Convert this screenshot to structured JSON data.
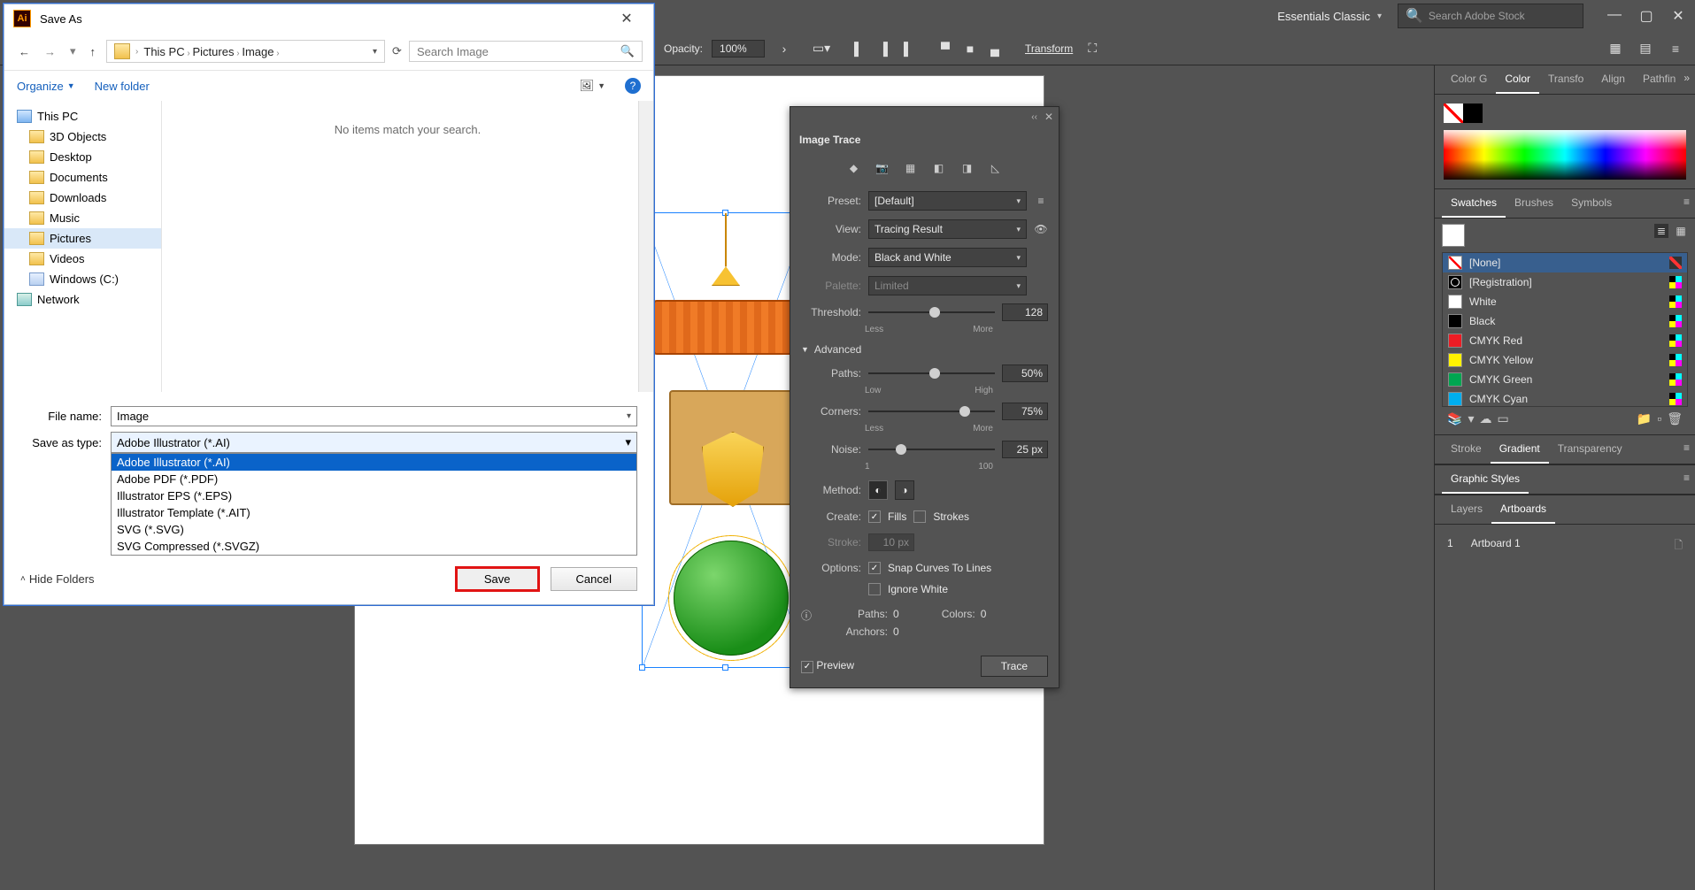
{
  "menubar": {
    "workspace": "Essentials Classic",
    "stock_placeholder": "Search Adobe Stock"
  },
  "options_bar": {
    "opacity_label": "Opacity:",
    "opacity_value": "100%",
    "transform_label": "Transform"
  },
  "image_trace": {
    "title": "Image Trace",
    "preset_label": "Preset:",
    "preset_value": "[Default]",
    "view_label": "View:",
    "view_value": "Tracing Result",
    "mode_label": "Mode:",
    "mode_value": "Black and White",
    "palette_label": "Palette:",
    "palette_value": "Limited",
    "threshold_label": "Threshold:",
    "threshold_value": "128",
    "threshold_min": "Less",
    "threshold_max": "More",
    "advanced": "Advanced",
    "paths_label": "Paths:",
    "paths_value": "50%",
    "paths_min": "Low",
    "paths_max": "High",
    "corners_label": "Corners:",
    "corners_value": "75%",
    "corners_min": "Less",
    "corners_max": "More",
    "noise_label": "Noise:",
    "noise_value": "25 px",
    "noise_min": "1",
    "noise_max": "100",
    "method_label": "Method:",
    "create_label": "Create:",
    "create_fills": "Fills",
    "create_strokes": "Strokes",
    "stroke_label": "Stroke:",
    "stroke_value": "10 px",
    "options_label": "Options:",
    "opt_snap": "Snap Curves To Lines",
    "opt_ignore": "Ignore White",
    "info_paths_k": "Paths:",
    "info_paths_v": "0",
    "info_colors_k": "Colors:",
    "info_colors_v": "0",
    "info_anchors_k": "Anchors:",
    "info_anchors_v": "0",
    "preview": "Preview",
    "trace_btn": "Trace"
  },
  "panels": {
    "color_tabs": [
      "Color G",
      "Color",
      "Transfo",
      "Align",
      "Pathfin"
    ],
    "color_active": "Color",
    "swatches_tabs": [
      "Swatches",
      "Brushes",
      "Symbols"
    ],
    "swatches_active": "Swatches",
    "swatches": [
      {
        "name": "[None]",
        "chip": "none",
        "icon": "noprint",
        "selected": true
      },
      {
        "name": "[Registration]",
        "chip": "reg",
        "icon": "cmyk"
      },
      {
        "name": "White",
        "chip": "#ffffff",
        "icon": "cmyk"
      },
      {
        "name": "Black",
        "chip": "#000000",
        "icon": "cmyk"
      },
      {
        "name": "CMYK Red",
        "chip": "#ed1c24",
        "icon": "cmyk"
      },
      {
        "name": "CMYK Yellow",
        "chip": "#fff200",
        "icon": "cmyk"
      },
      {
        "name": "CMYK Green",
        "chip": "#00a651",
        "icon": "cmyk"
      },
      {
        "name": "CMYK Cyan",
        "chip": "#00aeef",
        "icon": "cmyk"
      }
    ],
    "stroke_tabs": [
      "Stroke",
      "Gradient",
      "Transparency"
    ],
    "stroke_active": "Gradient",
    "graphic_styles": "Graphic Styles",
    "layers_tabs": [
      "Layers",
      "Artboards"
    ],
    "layers_active": "Artboards",
    "artboard_num": "1",
    "artboard_name": "Artboard 1"
  },
  "save_dialog": {
    "title": "Save As",
    "crumbs": [
      "This PC",
      "Pictures",
      "Image"
    ],
    "search_placeholder": "Search Image",
    "organize": "Organize",
    "new_folder": "New folder",
    "empty_msg": "No items match your search.",
    "tree": [
      {
        "label": "This PC",
        "icon": "pc",
        "root": true
      },
      {
        "label": "3D Objects",
        "icon": "folder"
      },
      {
        "label": "Desktop",
        "icon": "folder"
      },
      {
        "label": "Documents",
        "icon": "folder"
      },
      {
        "label": "Downloads",
        "icon": "folder"
      },
      {
        "label": "Music",
        "icon": "folder"
      },
      {
        "label": "Pictures",
        "icon": "folder",
        "selected": true
      },
      {
        "label": "Videos",
        "icon": "folder"
      },
      {
        "label": "Windows (C:)",
        "icon": "drive"
      },
      {
        "label": "Network",
        "icon": "net",
        "root": true
      }
    ],
    "file_name_label": "File name:",
    "file_name_value": "Image",
    "save_type_label": "Save as type:",
    "save_type_value": "Adobe Illustrator (*.AI)",
    "type_options": [
      "Adobe Illustrator (*.AI)",
      "Adobe PDF (*.PDF)",
      "Illustrator EPS (*.EPS)",
      "Illustrator Template (*.AIT)",
      "SVG (*.SVG)",
      "SVG Compressed (*.SVGZ)"
    ],
    "hide_folders": "Hide Folders",
    "save_btn": "Save",
    "cancel_btn": "Cancel"
  }
}
